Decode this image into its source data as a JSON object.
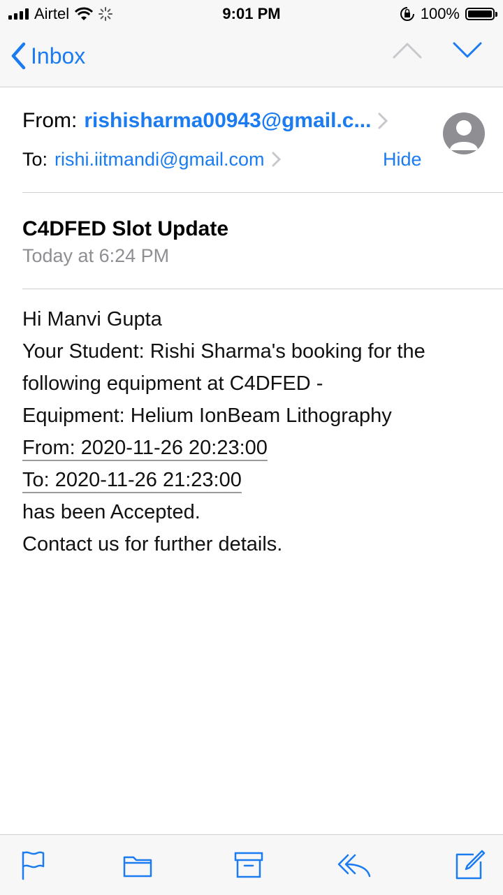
{
  "status_bar": {
    "carrier": "Airtel",
    "time": "9:01 PM",
    "battery": "100%"
  },
  "nav": {
    "back_label": "Inbox"
  },
  "header": {
    "from_label": "From:",
    "from_value": "rishisharma00943@gmail.c...",
    "to_label": "To:",
    "to_value": "rishi.iitmandi@gmail.com",
    "hide_label": "Hide"
  },
  "message": {
    "subject": "C4DFED Slot Update",
    "date": "Today at 6:24 PM",
    "body": [
      "Hi Manvi Gupta",
      "Your Student: Rishi Sharma's booking for the",
      "following equipment at C4DFED -",
      "Equipment: Helium IonBeam Lithography",
      "From: 2020-11-26 20:23:00",
      "To: 2020-11-26 21:23:00",
      "has been Accepted.",
      "Contact us for further details."
    ]
  },
  "icons": {
    "accent": "#1a7cf0",
    "toolbar": [
      "flag-icon",
      "folder-icon",
      "archive-icon",
      "reply-icon",
      "compose-icon"
    ]
  }
}
